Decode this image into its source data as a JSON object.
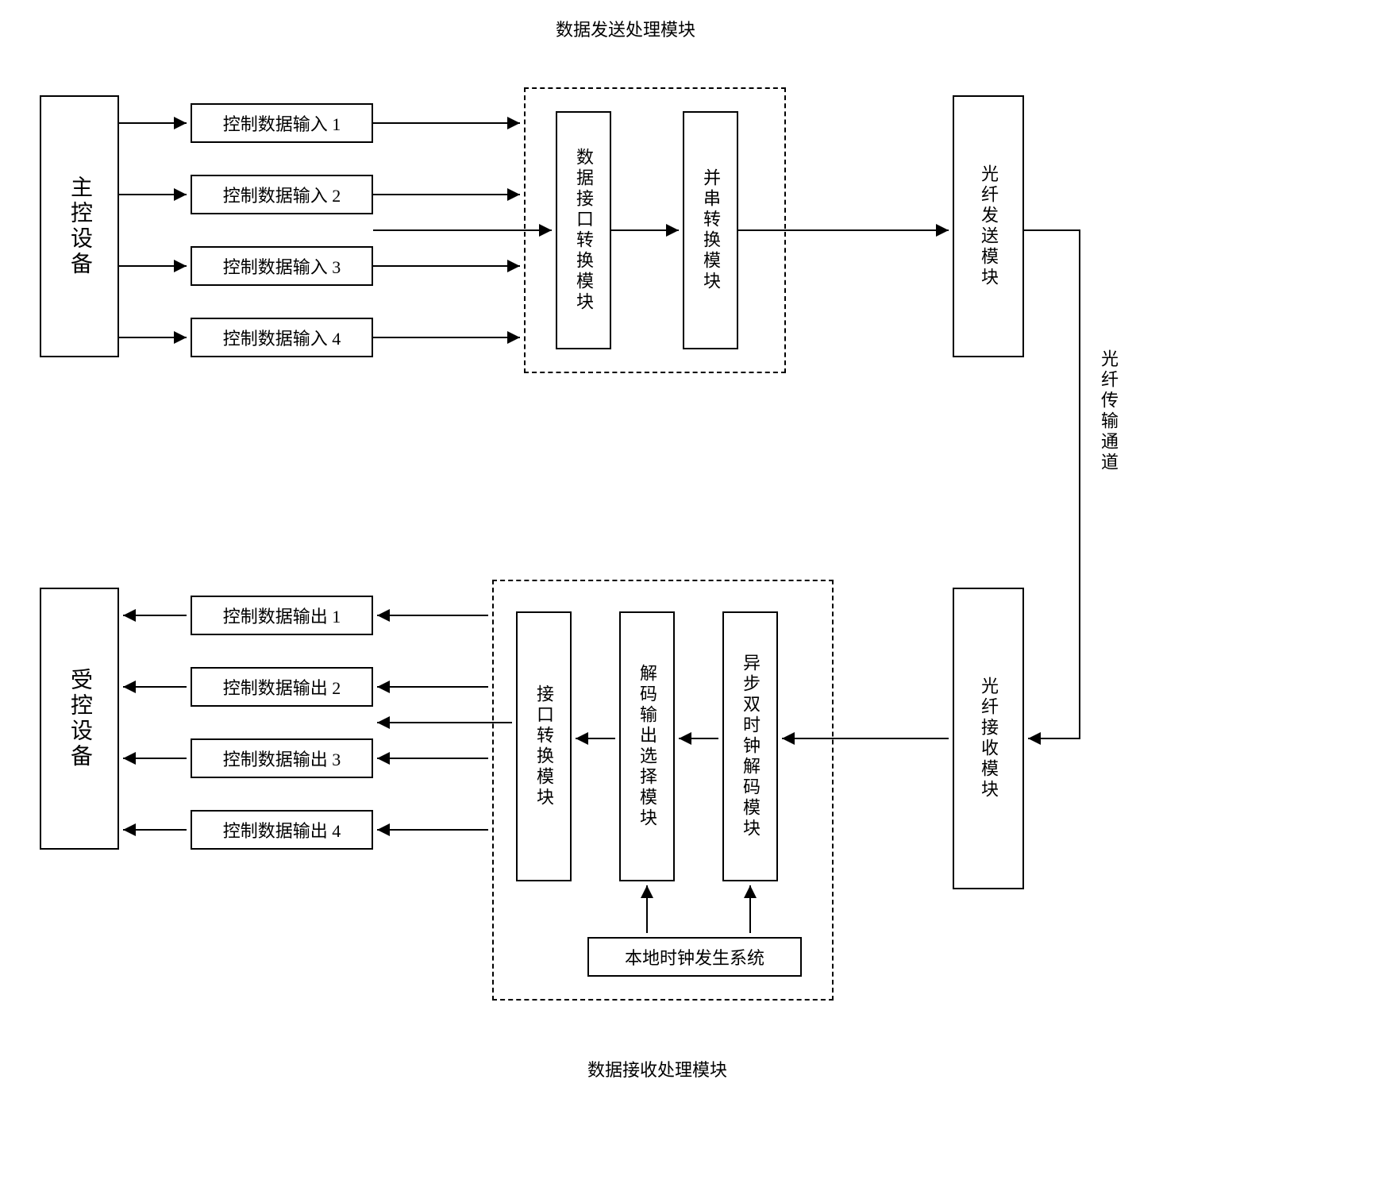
{
  "title_top": "数据发送处理模块",
  "title_bottom": "数据接收处理模块",
  "master": "主控设备",
  "slave": "受控设备",
  "inputs": [
    "控制数据输入 1",
    "控制数据输入 2",
    "控制数据输入 3",
    "控制数据输入 4"
  ],
  "outputs": [
    "控制数据输出 1",
    "控制数据输出 2",
    "控制数据输出 3",
    "控制数据输出 4"
  ],
  "send_inner1": "数据接口转换模块",
  "send_inner2": "并串转换模块",
  "fiber_send": "光纤发送模块",
  "fiber_channel": "光纤传输通道",
  "fiber_recv": "光纤接收模块",
  "recv_inner1": "接口转换模块",
  "recv_inner2": "解码输出选择模块",
  "recv_inner3": "异步双时钟解码模块",
  "clock_sys": "本地时钟发生系统"
}
